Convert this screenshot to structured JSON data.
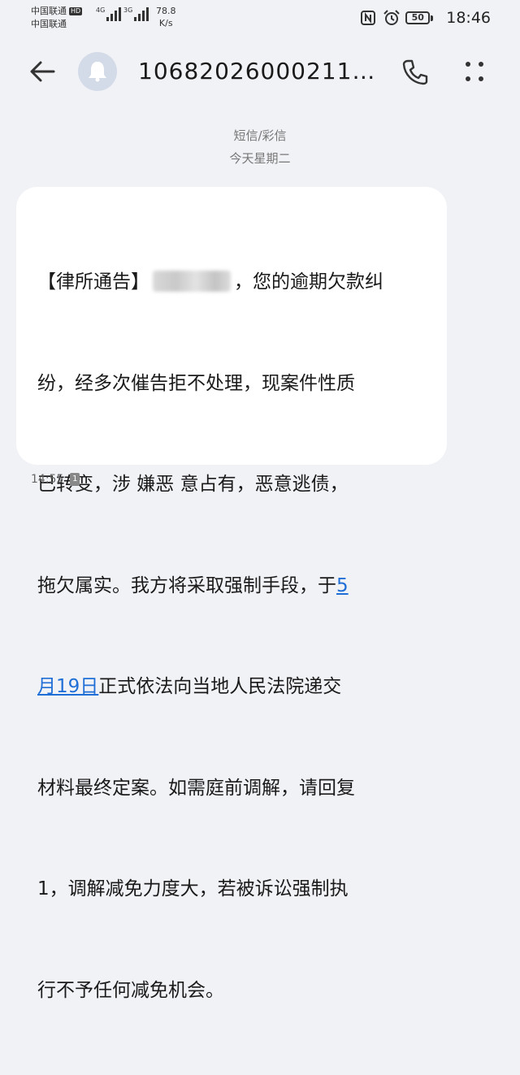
{
  "status_bar": {
    "carrier1": "中国联通",
    "hd": "HD",
    "carrier2": "中国联通",
    "net1": "4G",
    "net2": "3G",
    "speed_value": "78.8",
    "speed_unit": "K/s",
    "battery": "50",
    "time": "18:46"
  },
  "header": {
    "sender": "106820260002119..."
  },
  "conversation": {
    "type_label": "短信/彩信",
    "date_label": "今天星期二"
  },
  "message": {
    "line1_a": "【律所通告】",
    "line1_b": "，您的逾期欠款纠",
    "line2": "纷，经多次催告拒不处理，现案件性质",
    "line3": "已转变，涉 嫌恶 意占有，恶意逃债，",
    "line4_a": "拖欠属实。我方将采取强制手段，于",
    "line4_link": "5",
    "line5_link": "月19日",
    "line5_b": "正式依法向当地人民法院递交",
    "line6": "材料最终定案。如需庭前调解，请回复",
    "line7": "1，调解减免力度大，若被诉讼强制执",
    "line8": "行不予任何减免机会。",
    "time": "14:55",
    "sim": "1"
  },
  "colors": {
    "background": "#f1f2f6",
    "bubble": "#ffffff",
    "link": "#1f6fd6"
  },
  "icons": [
    "back-arrow-icon",
    "bell-icon",
    "phone-icon",
    "more-vertical-icon",
    "nfc-icon",
    "alarm-icon",
    "battery-icon",
    "sim-card-icon"
  ]
}
